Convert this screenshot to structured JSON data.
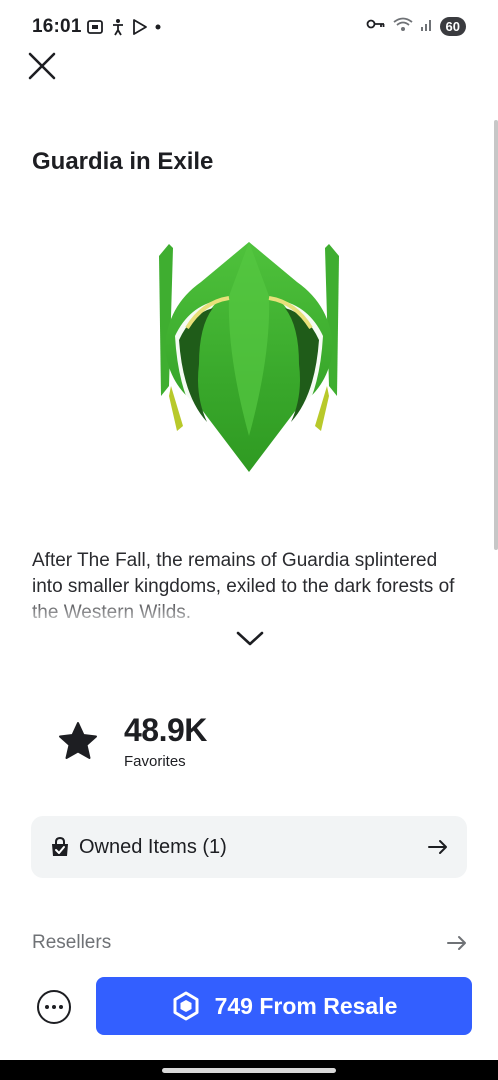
{
  "status_bar": {
    "time": "16:01",
    "battery": "60",
    "left_icons": [
      "screenshot-icon",
      "accessibility-icon",
      "play-store-icon",
      "dot-icon"
    ],
    "right_icons": [
      "vpn-key-icon",
      "wifi-icon",
      "signal-icon",
      "battery-icon"
    ]
  },
  "item": {
    "title": "Guardia in Exile",
    "description": "After The Fall, the remains of Guardia splintered into smaller kingdoms, exiled to the dark forests of the Western Wilds.",
    "image_icon": "green-helmet-image"
  },
  "favorites": {
    "count": "48.9K",
    "label": "Favorites"
  },
  "owned_items": {
    "label": "Owned Items (1)"
  },
  "resellers": {
    "label": "Resellers"
  },
  "purchase": {
    "label": "749 From Resale",
    "icon": "robux-icon"
  },
  "colors": {
    "accent": "#335fff",
    "card_bg": "#f2f4f5",
    "text": "#1d1e22",
    "muted": "#6f7276"
  }
}
